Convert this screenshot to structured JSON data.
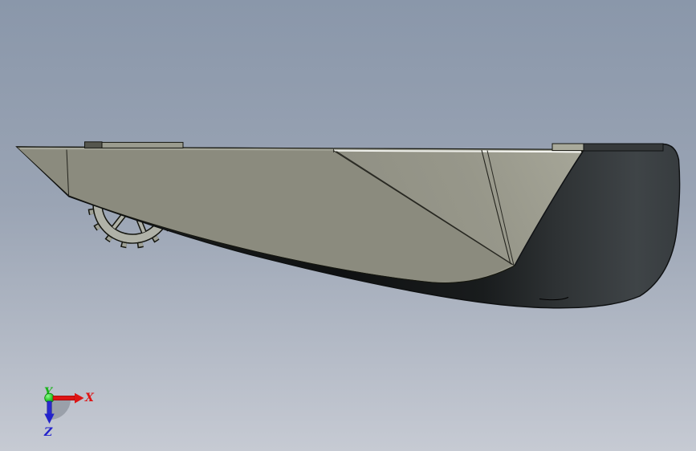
{
  "viewport": {
    "background_top_color": "#8A97AA",
    "background_bottom_color": "#C6CAD3"
  },
  "model": {
    "side_face_color": "#8E8E81",
    "dark_face_color": "#1A1D1E",
    "sprocket_color": "#B0B2A8",
    "highlight_color": "#EDEEE8"
  },
  "triad": {
    "x_label": "X",
    "y_label": "Y",
    "z_label": "Z",
    "x_color": "#DE1414",
    "y_color": "#17B317",
    "z_color": "#2323CB"
  }
}
